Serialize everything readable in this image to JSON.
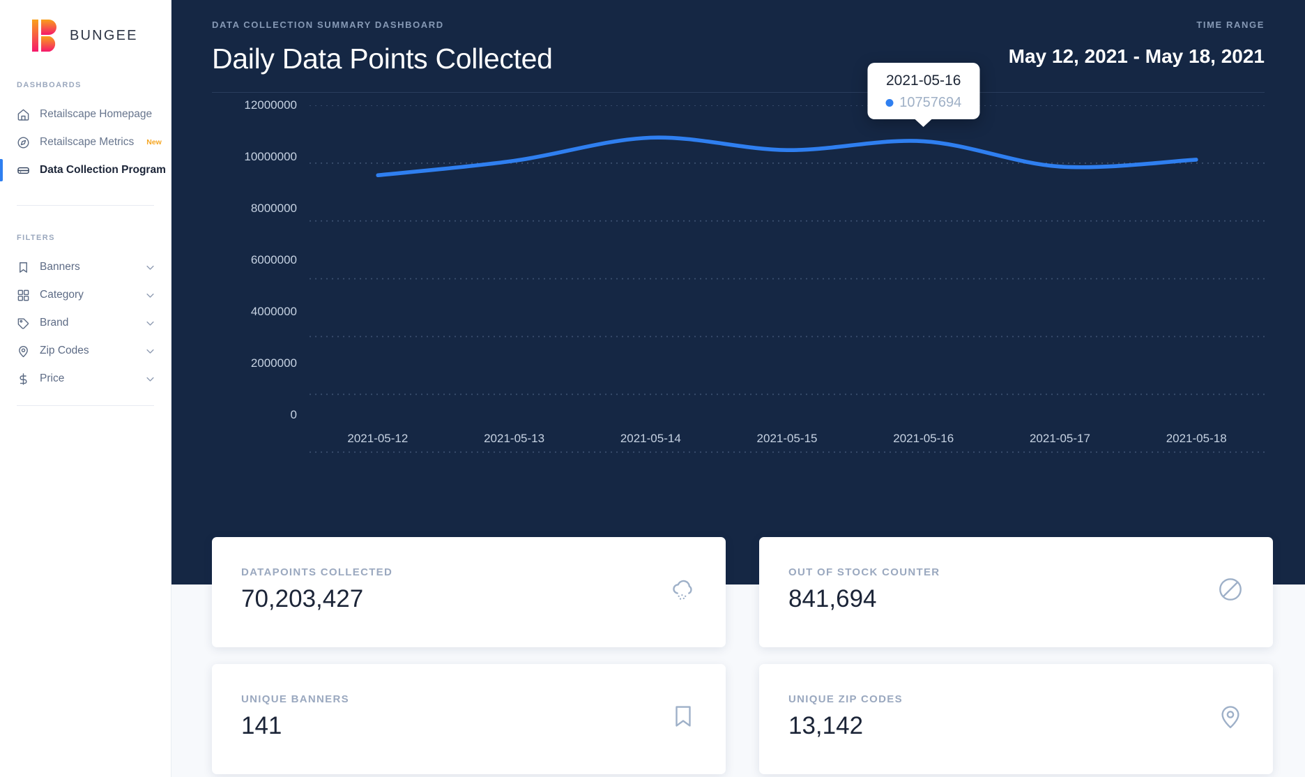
{
  "brand": {
    "name": "BUNGEE",
    "logo_icon": "bungee-logo"
  },
  "sidebar": {
    "dashboards_label": "DASHBOARDS",
    "filters_label": "FILTERS",
    "nav": [
      {
        "label": "Retailscape Homepage",
        "icon": "home-icon",
        "badge": ""
      },
      {
        "label": "Retailscape Metrics",
        "icon": "compass-icon",
        "badge": "New"
      },
      {
        "label": "Data Collection Program",
        "icon": "database-icon",
        "badge": ""
      }
    ],
    "filters": [
      {
        "label": "Banners",
        "icon": "bookmark-icon"
      },
      {
        "label": "Category",
        "icon": "grid-icon"
      },
      {
        "label": "Brand",
        "icon": "tag-icon"
      },
      {
        "label": "Zip Codes",
        "icon": "map-pin-icon"
      },
      {
        "label": "Price",
        "icon": "dollar-icon"
      }
    ]
  },
  "header": {
    "eyebrow": "DATA COLLECTION SUMMARY DASHBOARD",
    "title": "Daily Data Points Collected",
    "time_range_label": "TIME RANGE",
    "time_range_value": "May 12, 2021 - May 18, 2021"
  },
  "tooltip": {
    "date": "2021-05-16",
    "value": "10757694",
    "dot_color": "#2f7ff0"
  },
  "chart_data": {
    "type": "line",
    "title": "Daily Data Points Collected",
    "xlabel": "",
    "ylabel": "",
    "categories": [
      "2021-05-12",
      "2021-05-13",
      "2021-05-14",
      "2021-05-15",
      "2021-05-16",
      "2021-05-17",
      "2021-05-18"
    ],
    "x": [
      "2021-05-12",
      "2021-05-13",
      "2021-05-14",
      "2021-05-15",
      "2021-05-16",
      "2021-05-17",
      "2021-05-18"
    ],
    "values": [
      9580000,
      10080000,
      10880000,
      10450000,
      10757694,
      9880000,
      10120000
    ],
    "series": [
      {
        "name": "Datapoints",
        "color": "#2f7ff0",
        "values": [
          9580000,
          10080000,
          10880000,
          10450000,
          10757694,
          9880000,
          10120000
        ]
      }
    ],
    "ylim": [
      0,
      12000000
    ],
    "ytick_labels": [
      "12000000",
      "10000000",
      "8000000",
      "6000000",
      "4000000",
      "2000000",
      "0"
    ],
    "ytick_values": [
      12000000,
      10000000,
      8000000,
      6000000,
      4000000,
      2000000,
      0
    ],
    "grid": true,
    "grid_style": "dotted-horizontal",
    "legend": false,
    "line_color": "#2f7ff0",
    "background": "#152744"
  },
  "cards": [
    {
      "label": "DATAPOINTS COLLECTED",
      "value": "70,203,427",
      "icon": "cloud-drizzle-icon"
    },
    {
      "label": "OUT OF STOCK COUNTER",
      "value": "841,694",
      "icon": "slash-circle-icon"
    },
    {
      "label": "UNIQUE BANNERS",
      "value": "141",
      "icon": "bookmark-icon"
    },
    {
      "label": "UNIQUE ZIP CODES",
      "value": "13,142",
      "icon": "map-pin-icon"
    }
  ],
  "colors": {
    "accent": "#2f7ff0",
    "hero_bg": "#152744",
    "page_bg": "#f7f9fc",
    "badge": "#f5a623"
  }
}
